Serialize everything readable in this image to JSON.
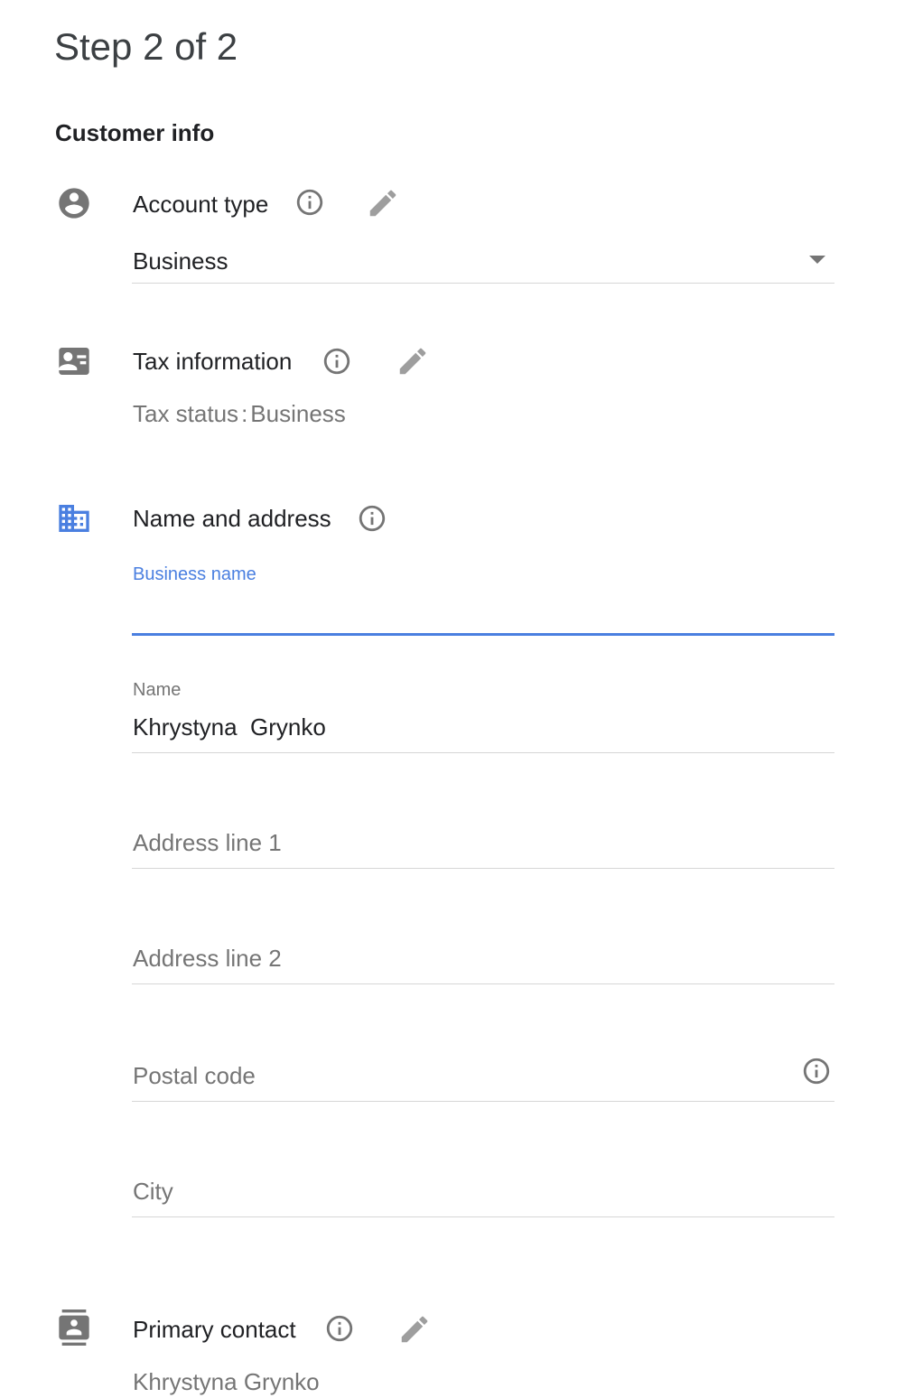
{
  "header": {
    "step_label": "Step 2 of 2",
    "section_title": "Customer info"
  },
  "account_type": {
    "title": "Account type",
    "icon": "account-circle-icon",
    "selected_value": "Business"
  },
  "tax_information": {
    "title": "Tax information",
    "icon": "contact-card-icon",
    "status_label": "Tax status",
    "status_separator": ":",
    "status_value": "Business"
  },
  "name_and_address": {
    "title": "Name and address",
    "icon": "business-building-icon",
    "business_name": {
      "label": "Business name",
      "value": ""
    },
    "name": {
      "label": "Name",
      "value": "Khrystyna  Grynko"
    },
    "address_line_1": {
      "placeholder": "Address line 1",
      "value": ""
    },
    "address_line_2": {
      "placeholder": "Address line 2",
      "value": ""
    },
    "postal_code": {
      "placeholder": "Postal code",
      "value": ""
    },
    "city": {
      "placeholder": "City",
      "value": ""
    }
  },
  "primary_contact": {
    "title": "Primary contact",
    "icon": "contacts-icon",
    "value": "Khrystyna Grynko"
  },
  "colors": {
    "accent": "#4a7fe0",
    "icon_gray": "#757575",
    "text_primary": "#202124",
    "text_secondary": "#757575",
    "divider": "#d6d6d6"
  }
}
